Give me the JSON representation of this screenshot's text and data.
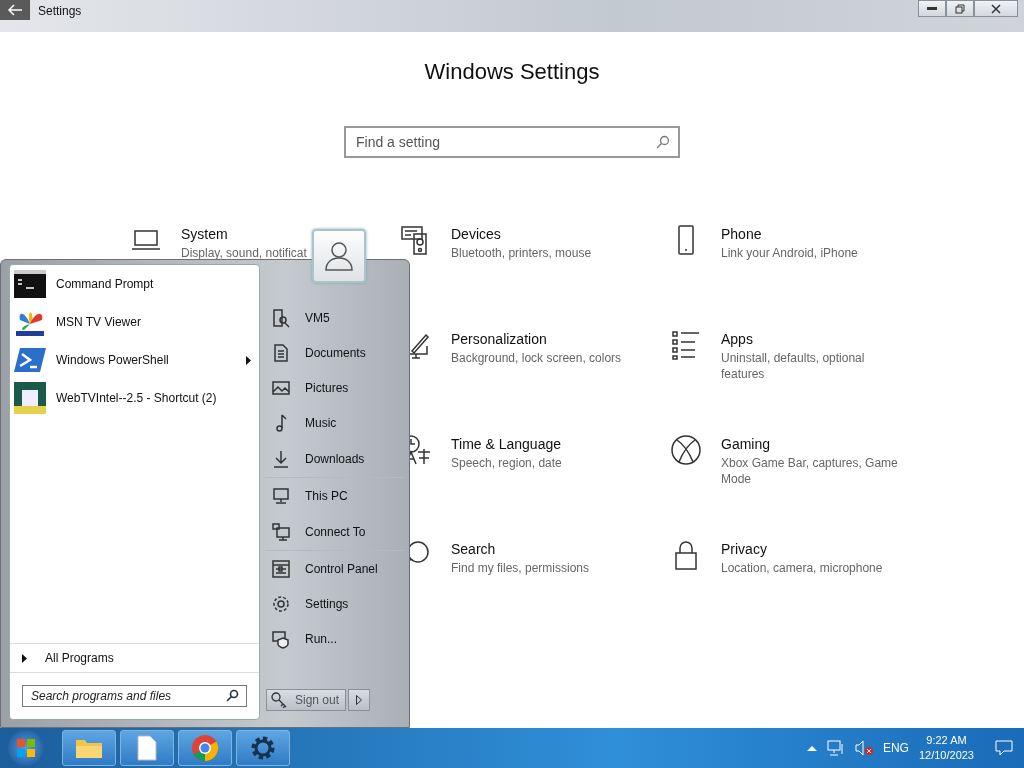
{
  "window": {
    "title": "Settings"
  },
  "heading": "Windows Settings",
  "search": {
    "placeholder": "Find a setting"
  },
  "category_rows": [
    {
      "items": [
        {
          "name": "System",
          "description": "Display, sound, notificat"
        },
        {
          "name": "Devices",
          "description": "Bluetooth, printers, mouse"
        },
        {
          "name": "Phone",
          "description": "Link your Android, iPhone"
        }
      ]
    },
    {
      "items": [
        {
          "name": "Personalization",
          "description": "Background, lock screen, colors"
        },
        {
          "name": "Apps",
          "description": "Uninstall, defaults, optional features"
        }
      ]
    },
    {
      "items": [
        {
          "name": "Time & Language",
          "description": "Speech, region, date"
        },
        {
          "name": "Gaming",
          "description": "Xbox Game Bar, captures, Game Mode"
        }
      ]
    },
    {
      "items": [
        {
          "name": "Search",
          "description": "Find my files, permissions"
        },
        {
          "name": "Privacy",
          "description": "Location, camera, microphone"
        }
      ]
    }
  ],
  "start_menu": {
    "programs": [
      {
        "label": "Command Prompt",
        "has_submenu": false
      },
      {
        "label": "MSN TV Viewer",
        "has_submenu": false
      },
      {
        "label": "Windows PowerShell",
        "has_submenu": true
      },
      {
        "label": "WebTVIntel--2.5 - Shortcut (2)",
        "has_submenu": false
      }
    ],
    "all_programs": "All Programs",
    "search": {
      "placeholder": "Search programs and files"
    },
    "places": [
      {
        "label": "VM5",
        "divider_after": false
      },
      {
        "label": "Documents",
        "divider_after": false
      },
      {
        "label": "Pictures",
        "divider_after": false
      },
      {
        "label": "Music",
        "divider_after": false
      },
      {
        "label": "Downloads",
        "divider_after": true
      },
      {
        "label": "This PC",
        "divider_after": false
      },
      {
        "label": "Connect To",
        "divider_after": true
      },
      {
        "label": "Control Panel",
        "divider_after": false
      },
      {
        "label": "Settings",
        "divider_after": false
      },
      {
        "label": "Run...",
        "divider_after": false
      }
    ],
    "sign_out": "Sign out"
  },
  "tray": {
    "language": "ENG",
    "time": "9:22 AM",
    "date": "12/10/2023"
  }
}
